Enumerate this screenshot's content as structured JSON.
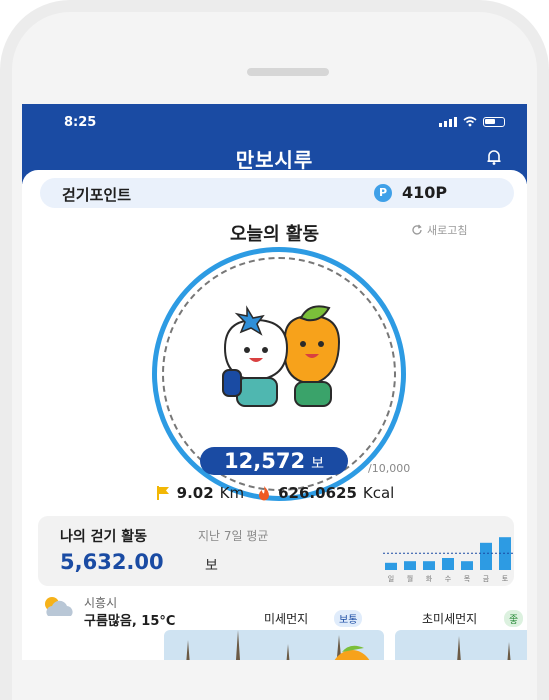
{
  "status_bar": {
    "time": "8:25"
  },
  "app": {
    "title": "만보시루"
  },
  "points": {
    "label": "걷기포인트",
    "icon_letter": "P",
    "value": "410P"
  },
  "activity": {
    "title": "오늘의 활동",
    "refresh_label": "새로고침",
    "steps": "12,572",
    "steps_unit": "보",
    "goal": "/10,000",
    "distance_value": "9.02",
    "distance_unit": "Km",
    "calories_value": "626.0625",
    "calories_unit": "Kcal"
  },
  "walking": {
    "title": "나의 걷기 활동",
    "subtitle": "지난 7일 평균",
    "average": "5,632.00",
    "unit": "보",
    "days": [
      "일",
      "월",
      "화",
      "수",
      "목",
      "금",
      "토"
    ],
    "day_values": [
      0.18,
      0.22,
      0.22,
      0.3,
      0.22,
      0.68,
      0.82
    ]
  },
  "weather": {
    "city": "시흥시",
    "description": "구름많음, 15°C",
    "fine_dust_label": "미세먼지",
    "fine_dust_status": "보통",
    "ultrafine_dust_label": "초미세먼지",
    "ultrafine_dust_status": "좋"
  },
  "colors": {
    "header": "#1a4ba3",
    "accent": "#2d9be3",
    "card": "#eaf1fb"
  }
}
